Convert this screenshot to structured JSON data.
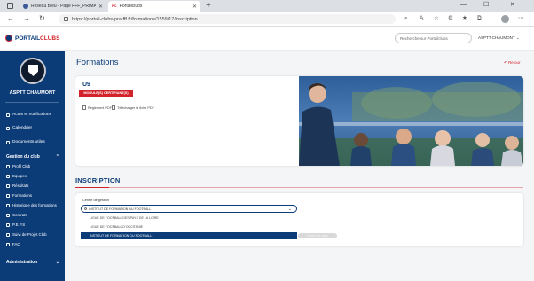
{
  "browser": {
    "tabs": [
      {
        "title": "Réseau Bleu - Page FFF_PRIMAT..."
      },
      {
        "title": "Portailclubs"
      }
    ],
    "url": "https://portail-clubs-pra.fff.fr/formations/1559/17/inscription"
  },
  "header": {
    "logo_part1": "PORTAIL",
    "logo_part2": "CLUBS",
    "search_placeholder": "Recherche sur Portailclubs",
    "user_name": "ASPTT CHAUMONT"
  },
  "sidebar": {
    "club_name": "ASPTT CHAUMONT",
    "items": [
      {
        "label": "Actus et notifications"
      },
      {
        "label": "Calendrier"
      },
      {
        "label": "Documents utiles"
      }
    ],
    "section_gestion": "Gestion du club",
    "sub_items": [
      {
        "label": "Profil Club"
      },
      {
        "label": "Equipes"
      },
      {
        "label": "Résultats"
      },
      {
        "label": "Formations"
      },
      {
        "label": "Historique des formations"
      },
      {
        "label": "Contrats"
      },
      {
        "label": "P.E.P.S"
      },
      {
        "label": "Suivi de Projet Club"
      },
      {
        "label": "FAQ"
      }
    ],
    "section_admin": "Administration"
  },
  "main": {
    "title": "Formations",
    "back_label": "Retour",
    "card": {
      "category": "U9",
      "badge": "MODULE(S) CERTIFIANT(S)",
      "doc1": "Règlement PDF",
      "doc2": "Télécharger la fiche PDF"
    },
    "inscription_title": "INSCRIPTION",
    "form": {
      "field_label": "Centre de gestion",
      "selected_value": "INSTITUT DE FORMATION DU FOOTBALL",
      "options": [
        "LIGUE DE FOOTBALL DES PAYS DE LA LOIRE",
        "LIGUE DE FOOTBALL D'OCCITANIE",
        "INSTITUT DE FORMATION DU FOOTBALL"
      ],
      "button_label": "Choisir les dates"
    }
  },
  "colors": {
    "navy": "#0b3c78",
    "red": "#d2232a"
  }
}
